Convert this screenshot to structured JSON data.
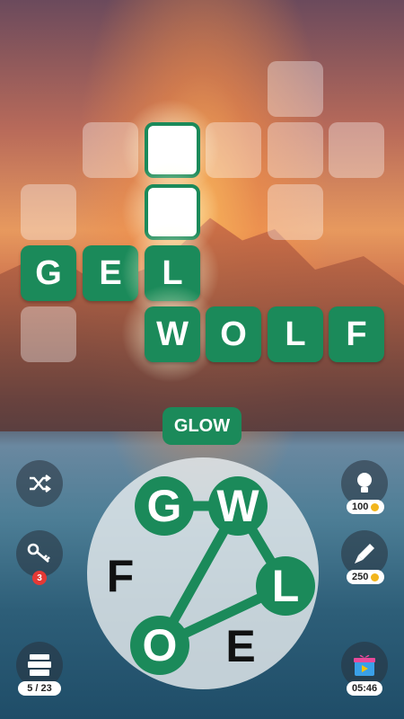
{
  "grid": {
    "row_gel": [
      "G",
      "E",
      "L"
    ],
    "row_wolf": [
      "W",
      "O",
      "L",
      "F"
    ]
  },
  "current_word": "GLOW",
  "wheel": {
    "letters": [
      "G",
      "W",
      "L",
      "E",
      "O",
      "F"
    ]
  },
  "controls": {
    "shuffle_icon": "shuffle-icon",
    "key_count": "3",
    "hint_cost": "100",
    "rocket_cost": "250",
    "levels_progress": "5 / 23",
    "timer": "05:46"
  },
  "colors": {
    "tile_green": "#1b8a5a",
    "coin": "#f2b51c",
    "badge_red": "#e53935"
  }
}
